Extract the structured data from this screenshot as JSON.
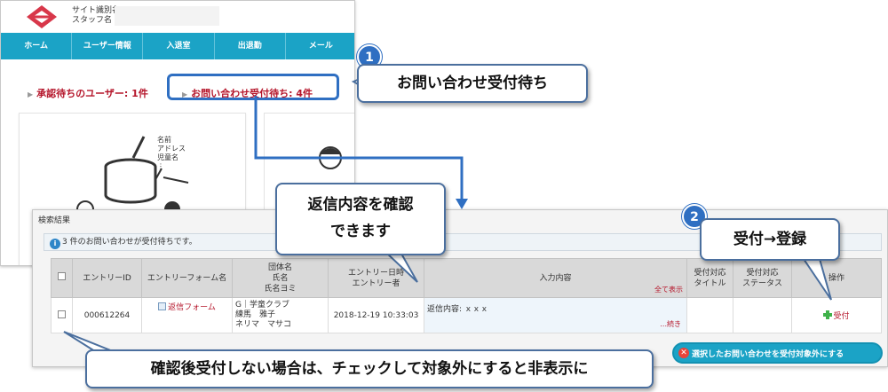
{
  "header": {
    "site_name": "サイト識別名",
    "staff_name": "スタッフ名"
  },
  "nav": [
    "ホーム",
    "ユーザー情報",
    "入退室",
    "出退勤",
    "メール"
  ],
  "pending": {
    "users": "承認待ちのユーザー: 1件",
    "inquiries": "お問い合わせ受付待ち: 4件"
  },
  "illustration": {
    "labels": [
      "名前",
      "アドレス",
      "児童名",
      "⋮"
    ]
  },
  "results": {
    "title": "検索結果",
    "notice": "3 件のお問い合わせが受付待ちです。",
    "columns": {
      "entry_id": "エントリーID",
      "form_name": "エントリーフォーム名",
      "group": [
        "団体名",
        "氏名",
        "氏名ヨミ"
      ],
      "datetime": [
        "エントリー日時",
        "エントリー者"
      ],
      "content": "入力内容",
      "show_all": "全て表示",
      "title": [
        "受付対応",
        "タイトル"
      ],
      "status": [
        "受付対応",
        "ステータス"
      ],
      "ops": "操作"
    },
    "rows": [
      {
        "entry_id": "000612264",
        "form_name": "返信フォーム",
        "group": [
          "G｜学童クラブ",
          "練馬　雅子",
          "ネリマ　マサコ"
        ],
        "datetime": "2018-12-19 10:33:03",
        "content": "返信内容: ｘｘｘ",
        "more": "...続き",
        "accept": "受付"
      }
    ],
    "exclude_button": "選択したお問い合わせを受付対象外にする"
  },
  "annotations": {
    "badge1": "1",
    "badge2": "2",
    "callout1": "お問い合わせ受付待ち",
    "callout2_lines": [
      "返信内容を確認",
      "できます"
    ],
    "callout3": "受付→登録",
    "callout4": "確認後受付しない場合は、チェックして対象外にすると非表示に"
  },
  "colors": {
    "nav": "#1ba3c6",
    "accent_red": "#b5162b",
    "annotation_blue": "#2f6fc2"
  }
}
